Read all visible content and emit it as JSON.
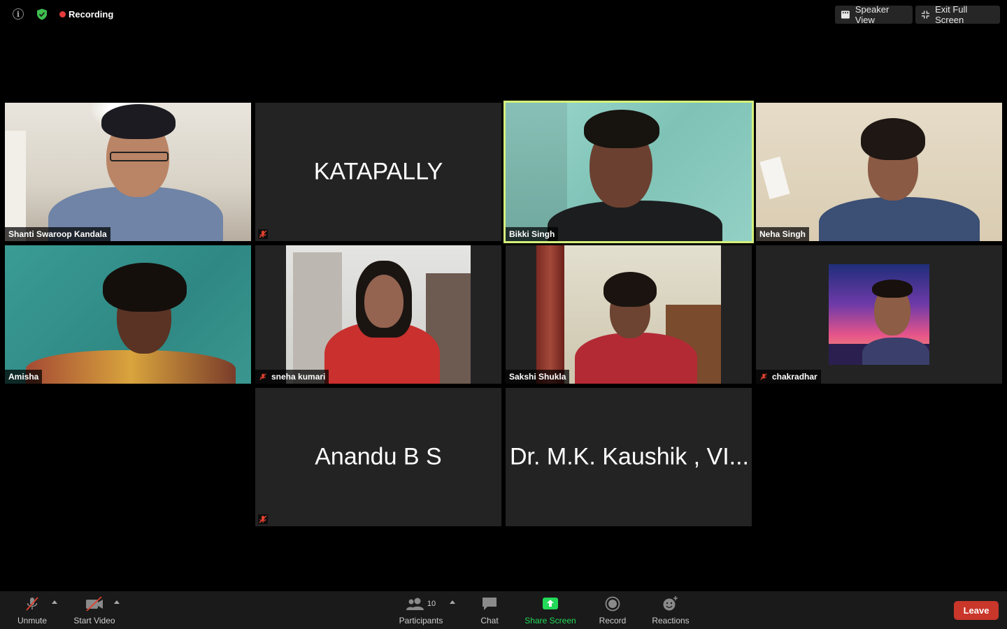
{
  "top_bar": {
    "recording_label": "Recording",
    "speaker_view_label": "Speaker View",
    "exit_full_screen_label": "Exit Full Screen",
    "recording_color": "#e53b3b"
  },
  "participants": [
    {
      "name": "Shanti Swaroop Kandala",
      "video": true,
      "muted": false,
      "active": false
    },
    {
      "name": "KATAPALLY",
      "display_name": "KATAPALLY",
      "video": false,
      "muted": true,
      "active": false
    },
    {
      "name": "Bikki Singh",
      "video": true,
      "muted": false,
      "active": true
    },
    {
      "name": "Neha Singh",
      "video": true,
      "muted": false,
      "active": false
    },
    {
      "name": "Amisha",
      "video": true,
      "muted": false,
      "active": false
    },
    {
      "name": "sneha kumari",
      "video": true,
      "muted": true,
      "active": false
    },
    {
      "name": "Sakshi Shukla",
      "video": true,
      "muted": false,
      "active": false
    },
    {
      "name": "chakradhar",
      "video": true,
      "muted": true,
      "active": false
    },
    {
      "name": "Anandu B S",
      "display_name": "Anandu B S",
      "video": false,
      "muted": true,
      "active": false
    },
    {
      "name": "Dr. M.K. Kaushik , VI...",
      "display_name": "Dr. M.K. Kaushik , VI...",
      "video": false,
      "muted": false,
      "active": false
    }
  ],
  "toolbar": {
    "unmute_label": "Unmute",
    "start_video_label": "Start Video",
    "participants_label": "Participants",
    "participants_count": "10",
    "chat_label": "Chat",
    "share_screen_label": "Share Screen",
    "record_label": "Record",
    "reactions_label": "Reactions",
    "leave_label": "Leave",
    "share_color": "#23d959",
    "leave_color": "#c9362a",
    "active_outline_color": "#d4f07b"
  }
}
